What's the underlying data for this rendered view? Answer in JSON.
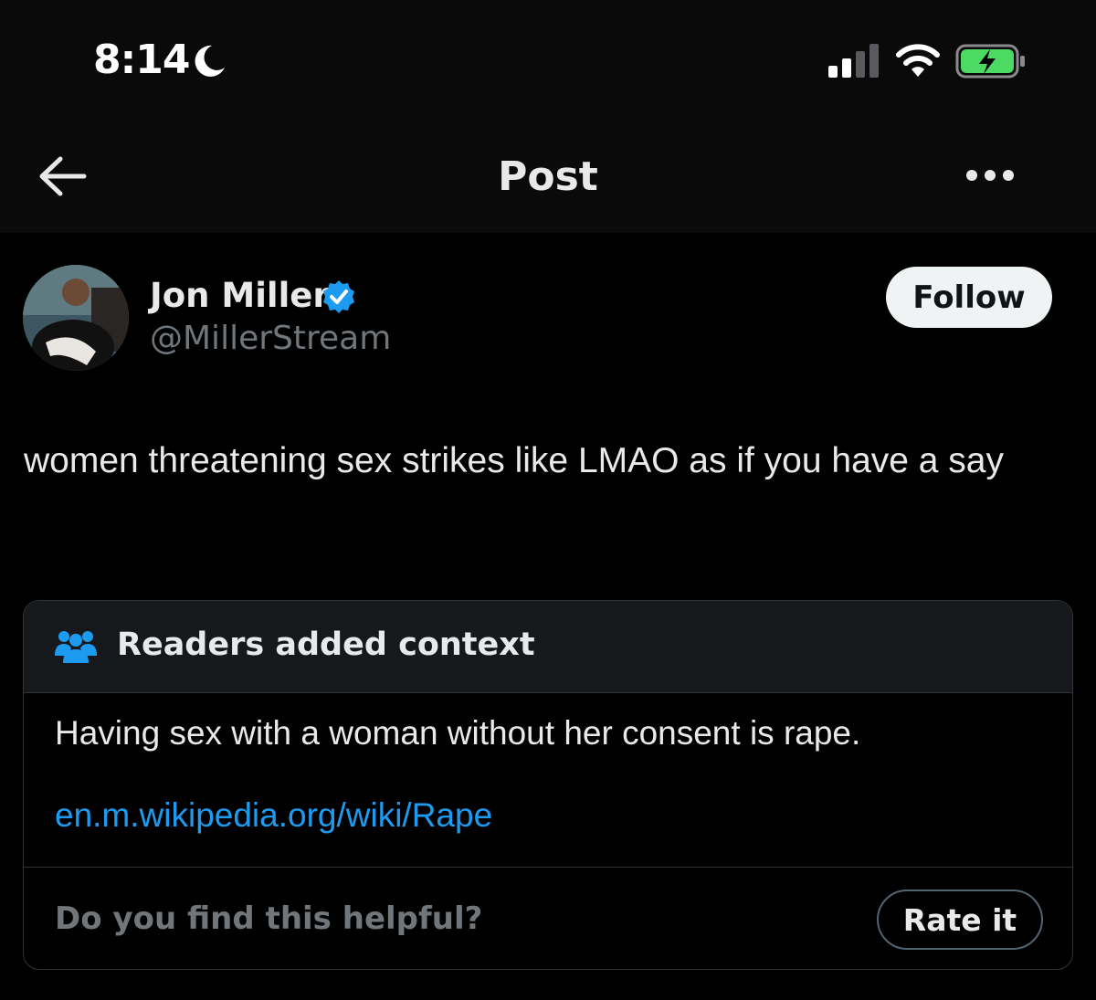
{
  "status_bar": {
    "time": "8:14",
    "focus_icon": "moon-icon",
    "signal_icon": "cellular-signal-icon",
    "wifi_icon": "wifi-icon",
    "battery_icon": "battery-charging-icon",
    "battery_color": "#4cd964"
  },
  "nav": {
    "back_icon": "back-arrow-icon",
    "title": "Post",
    "more_icon": "more-horizontal-icon"
  },
  "post": {
    "author_name": "Jon Miller",
    "verified_icon": "verified-badge-icon",
    "handle": "@MillerStream",
    "follow_label": "Follow",
    "text": "women threatening sex strikes like LMAO as if you have a say"
  },
  "community_note": {
    "icon": "people-icon",
    "title": "Readers added context",
    "body": "Having sex with a woman without her consent is rape.",
    "link": "en.m.wikipedia.org/wiki/Rape",
    "helpful_prompt": "Do you find this helpful?",
    "rate_label": "Rate it"
  },
  "colors": {
    "accent_blue": "#1d9bf0",
    "background": "#000000",
    "text_primary": "#e7e9ea",
    "text_secondary": "#71767b"
  }
}
